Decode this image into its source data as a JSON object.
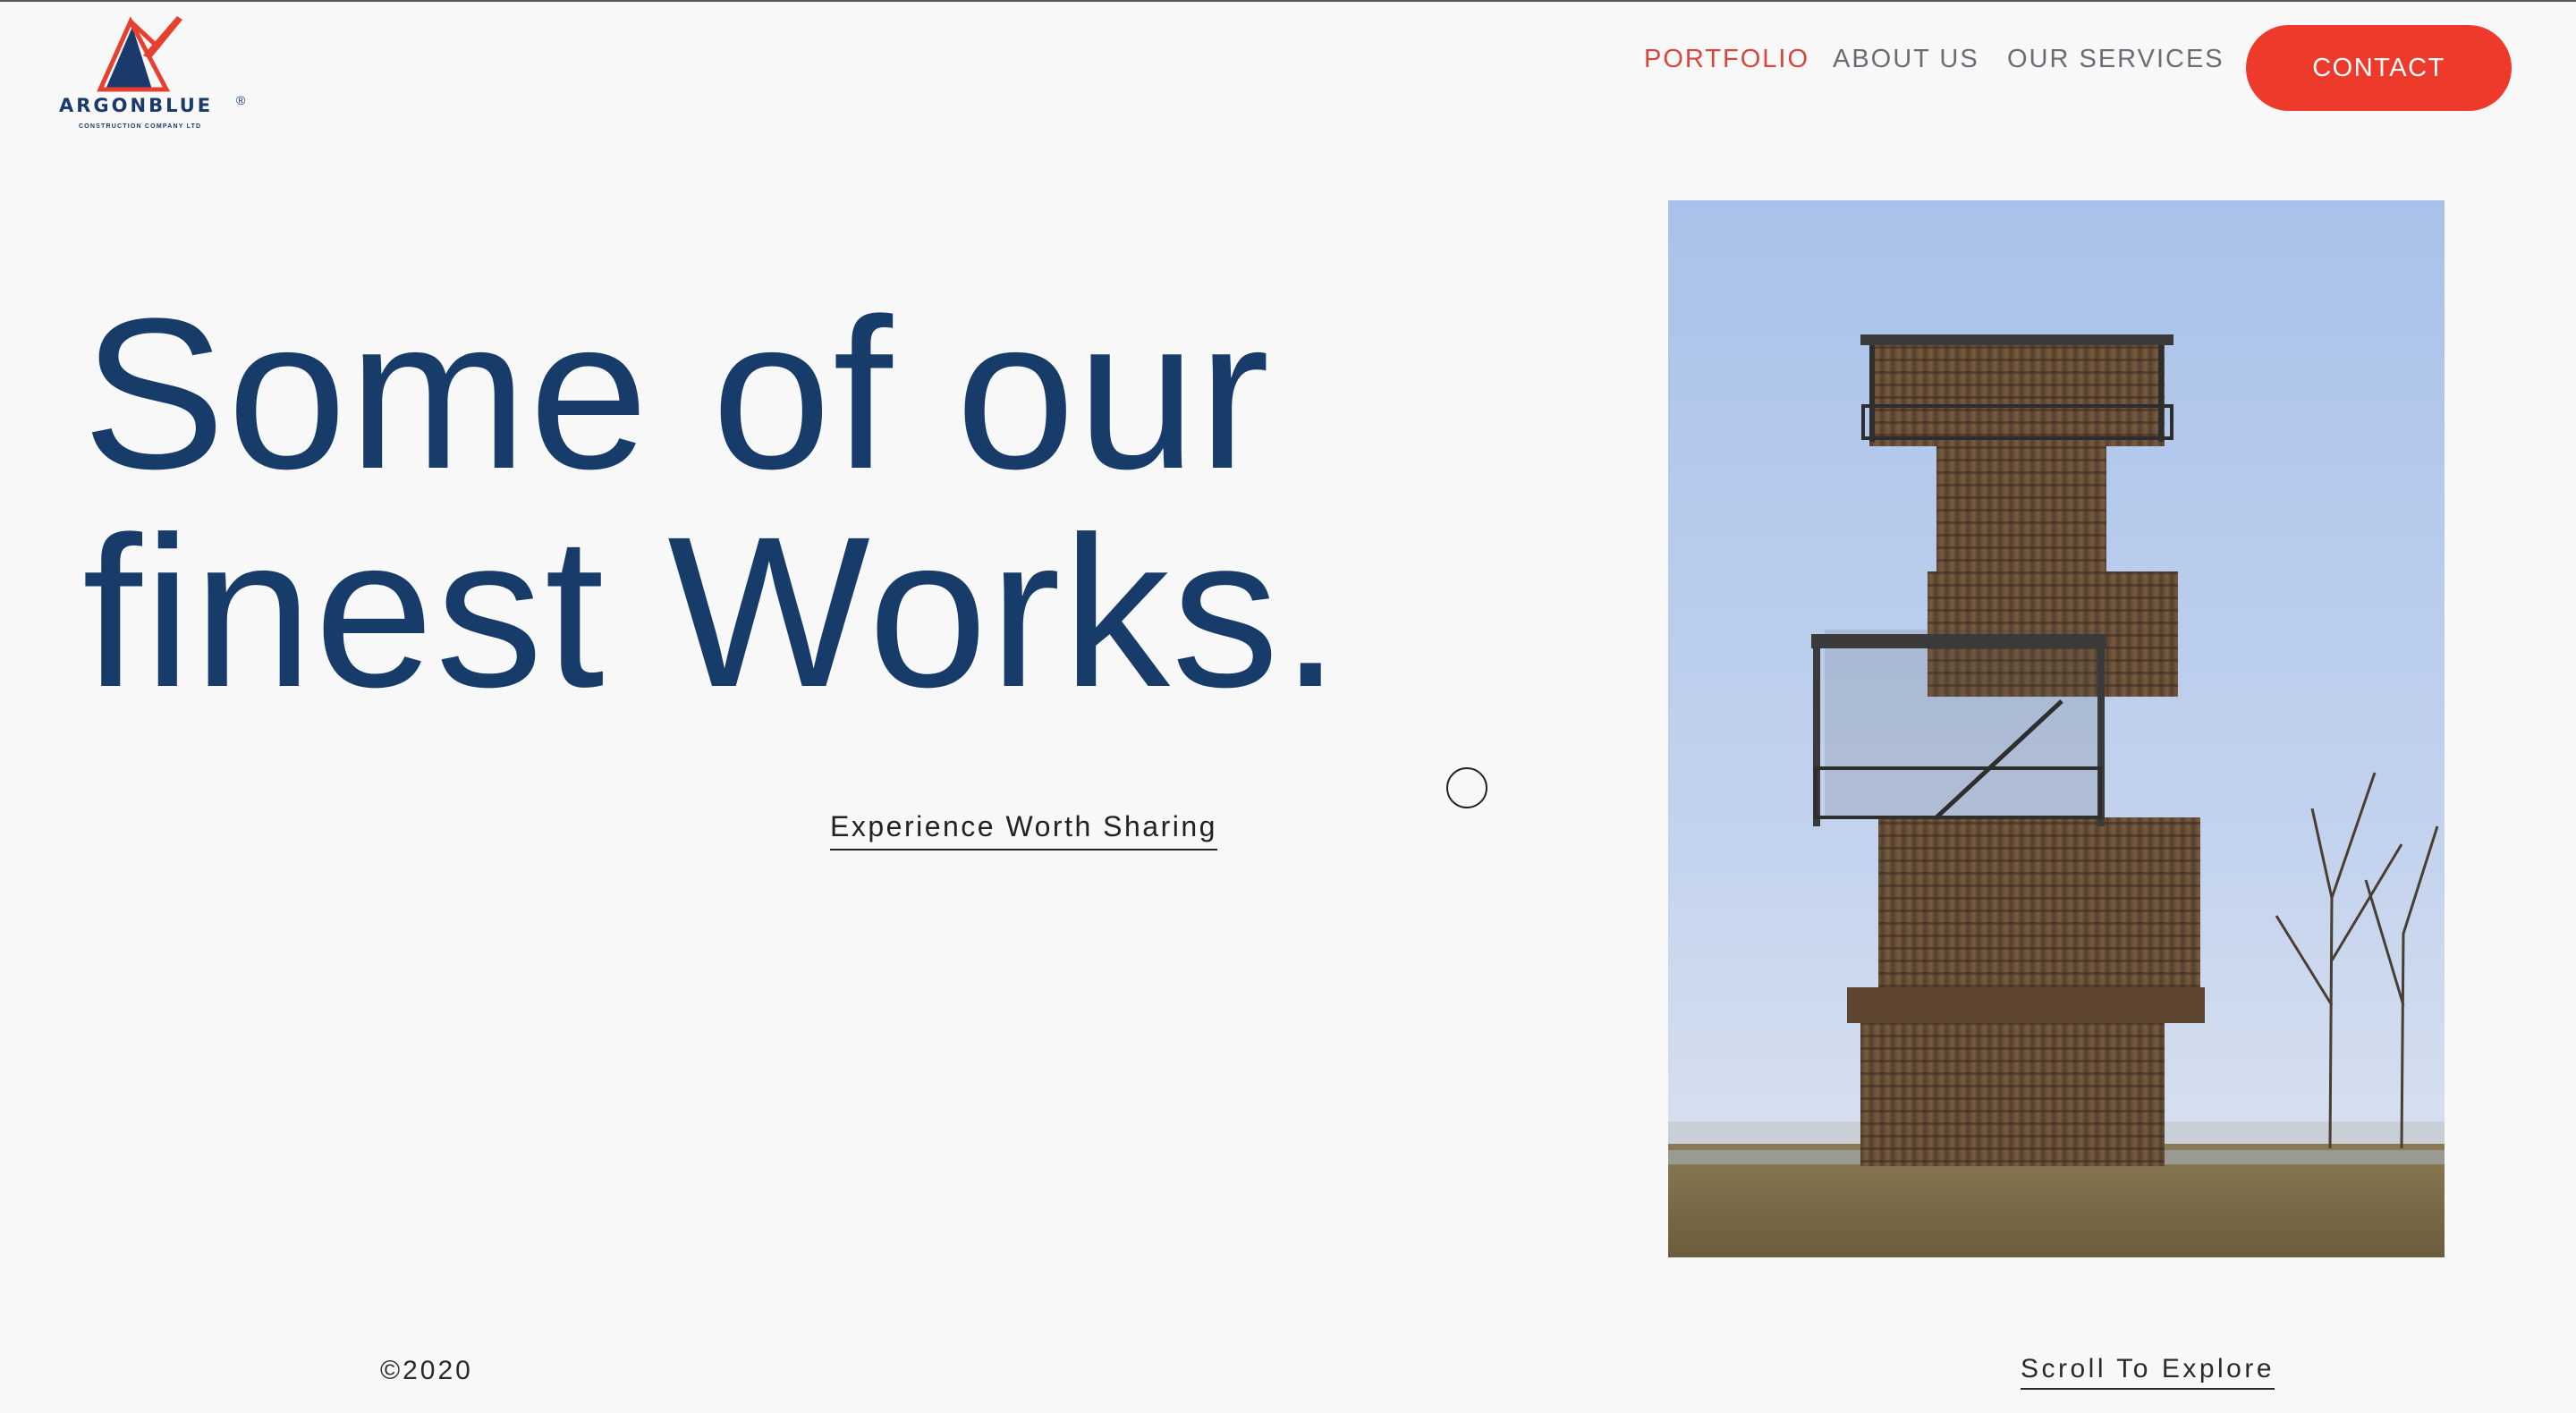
{
  "brand": {
    "name": "ARGONBLUE",
    "registered_mark": "®",
    "tagline": "CONSTRUCTION COMPANY LTD",
    "logo_icon": "mountain-triangle-logo",
    "colors": {
      "navy": "#1a3a6b",
      "red": "#e8402f"
    }
  },
  "nav": {
    "items": [
      {
        "label": "PORTFOLIO",
        "active": true
      },
      {
        "label": "ABOUT US",
        "active": false
      },
      {
        "label": "OUR SERVICES",
        "active": false
      }
    ],
    "contact_label": "CONTACT",
    "colors": {
      "active": "#d7463d",
      "inactive": "#6c6c74",
      "contact_bg": "#ee3a2b"
    }
  },
  "hero": {
    "title_line1": "Some of our",
    "title_line2": "finest Works.",
    "cta_label": "Experience Worth Sharing",
    "title_color": "#183c6a"
  },
  "photo": {
    "subject": "wooden observation tower"
  },
  "footer": {
    "copyright": "©2020",
    "scroll_label": "Scroll To Explore"
  }
}
